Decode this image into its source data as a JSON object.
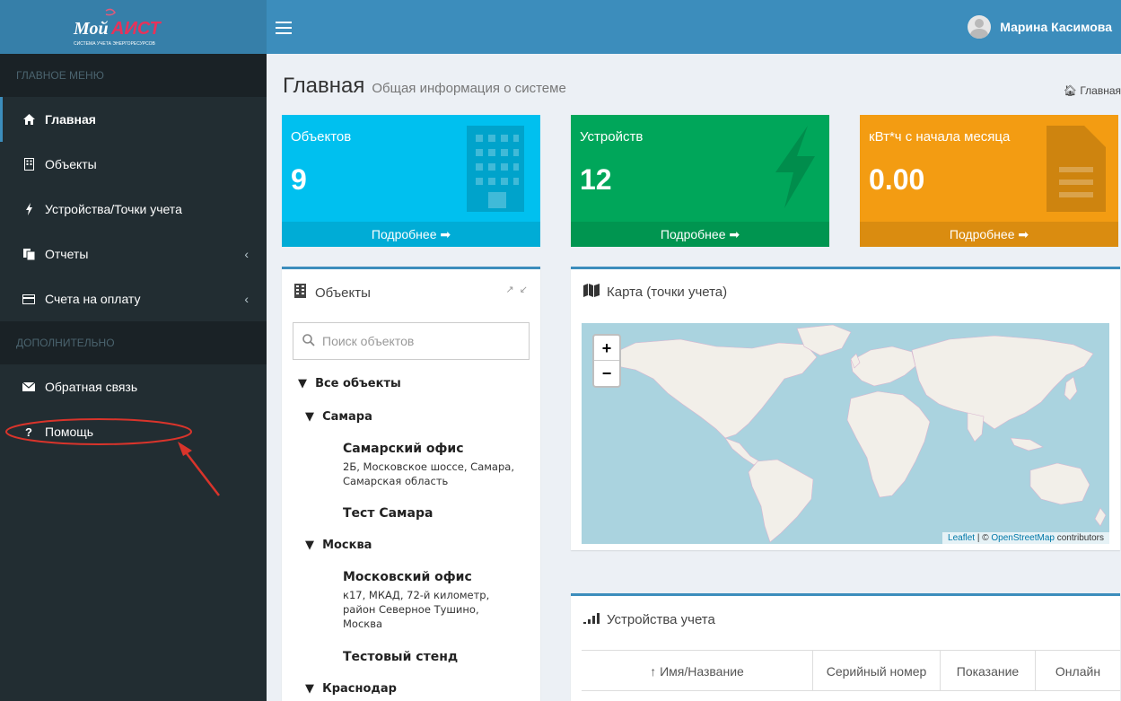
{
  "logo": {
    "name": "МойАИСТ",
    "tagline": "СИСТЕМА УЧЕТА ЭНЕРГОРЕСУРСОВ"
  },
  "header": {
    "user_name": "Марина Касимова"
  },
  "sidebar": {
    "main_header": "ГЛАВНОЕ МЕНЮ",
    "items": [
      {
        "label": "Главная",
        "icon": "home-icon"
      },
      {
        "label": "Объекты",
        "icon": "building-icon"
      },
      {
        "label": "Устройства/Точки учета",
        "icon": "bolt-icon"
      },
      {
        "label": "Отчеты",
        "icon": "files-icon"
      },
      {
        "label": "Счета на оплату",
        "icon": "credit-card-icon"
      }
    ],
    "extra_header": "ДОПОЛНИТЕЛЬНО",
    "extra_items": [
      {
        "label": "Обратная связь",
        "icon": "envelope-icon"
      },
      {
        "label": "Помощь",
        "icon": "question-icon"
      }
    ],
    "caret": "‹"
  },
  "page": {
    "title": "Главная",
    "subtitle": "Общая информация о системе",
    "breadcrumb": "Главная"
  },
  "tiles": [
    {
      "label": "Объектов",
      "value": "9",
      "more": "Подробнее",
      "color": "#00c0ef"
    },
    {
      "label": "Устройств",
      "value": "12",
      "more": "Подробнее",
      "color": "#00a65a"
    },
    {
      "label": "кВт*ч с начала месяца",
      "value": "0.00",
      "more": "Подробнее",
      "color": "#f39c12"
    }
  ],
  "objects_box": {
    "title": "Объекты",
    "search_placeholder": "Поиск объектов",
    "tree": {
      "root": "Все объекты",
      "samara": "Самара",
      "samara_office": "Самарский офис",
      "samara_office_addr": "2Б, Московское шоссе, Самара, Самарская область",
      "samara_test": "Тест Самара",
      "moscow": "Москва",
      "moscow_office": "Московский офис",
      "moscow_office_addr": "к17, МКАД, 72-й километр, район Северное Тушино, Москва",
      "moscow_test": "Тестовый стенд",
      "krasnodar": "Краснодар"
    }
  },
  "map_box": {
    "title": "Карта (точки учета)",
    "zoom_in": "+",
    "zoom_out": "−",
    "attribution_leaflet": "Leaflet",
    "attribution_sep": " | © ",
    "attribution_osm": "OpenStreetMap",
    "attribution_rest": " contributors"
  },
  "devices_box": {
    "title": "Устройства учета",
    "columns": [
      "↑ Имя/Название",
      "Серийный номер",
      "Показание",
      "Онлайн"
    ]
  },
  "colors": {
    "brand": "#3c8dbc",
    "sidebar": "#222d32",
    "annotation": "#d9342b"
  }
}
